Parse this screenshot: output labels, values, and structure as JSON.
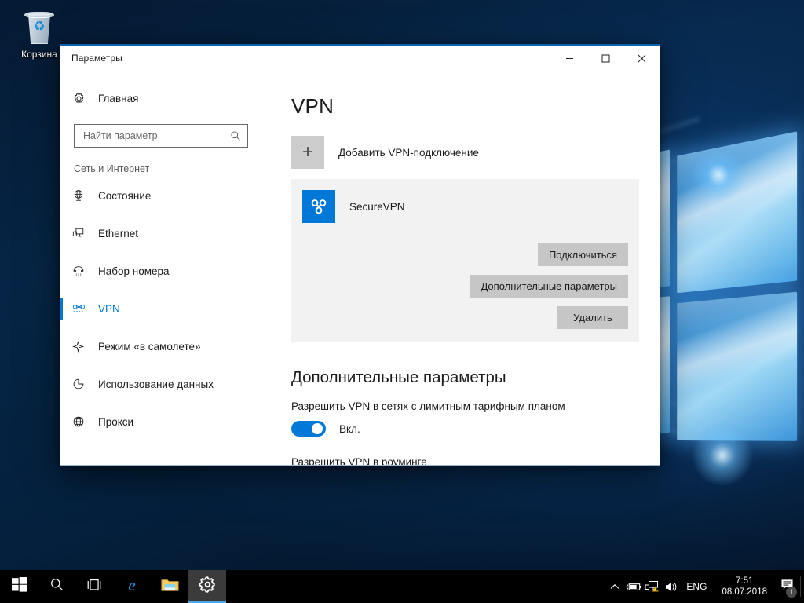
{
  "desktop": {
    "recycle_bin_label": "Корзина",
    "wallpaper_accent": "#0c67b5"
  },
  "window": {
    "title": "Параметры",
    "controls": {
      "minimize": "minimize-icon",
      "maximize": "maximize-icon",
      "close": "close-icon"
    }
  },
  "sidebar": {
    "home_label": "Главная",
    "home_icon": "gear-icon",
    "search": {
      "placeholder": "Найти параметр",
      "value": "",
      "icon": "search-icon"
    },
    "group_title": "Сеть и Интернет",
    "items": [
      {
        "label": "Состояние",
        "icon": "globe-status-icon",
        "active": false
      },
      {
        "label": "Ethernet",
        "icon": "ethernet-icon",
        "active": false
      },
      {
        "label": "Набор номера",
        "icon": "dialup-icon",
        "active": false
      },
      {
        "label": "VPN",
        "icon": "vpn-icon",
        "active": true
      },
      {
        "label": "Режим «в самолете»",
        "icon": "airplane-icon",
        "active": false
      },
      {
        "label": "Использование данных",
        "icon": "data-usage-icon",
        "active": false
      },
      {
        "label": "Прокси",
        "icon": "proxy-globe-icon",
        "active": false
      }
    ],
    "active_color": "#0078d7"
  },
  "main": {
    "page_title": "VPN",
    "add_connection": {
      "label": "Добавить VPN-подключение",
      "icon": "plus-icon"
    },
    "connection": {
      "name": "SecureVPN",
      "icon": "vpn-connection-icon",
      "icon_color": "#0078d7",
      "buttons": [
        {
          "label": "Подключиться",
          "name": "connect-button"
        },
        {
          "label": "Дополнительные параметры",
          "name": "advanced-options-button"
        },
        {
          "label": "Удалить",
          "name": "remove-button"
        }
      ]
    },
    "advanced": {
      "section_title": "Дополнительные параметры",
      "metered": {
        "label": "Разрешить VPN в сетях с лимитным тарифным планом",
        "state": "Вкл.",
        "on": true
      },
      "roaming": {
        "label": "Разрешить VPN в роуминге"
      }
    }
  },
  "taskbar": {
    "buttons": [
      {
        "name": "start-button",
        "icon": "windows-logo-icon",
        "active": false
      },
      {
        "name": "search-button",
        "icon": "search-icon",
        "active": false
      },
      {
        "name": "task-view-button",
        "icon": "task-view-icon",
        "active": false
      },
      {
        "name": "edge-button",
        "icon": "edge-icon",
        "active": false
      },
      {
        "name": "file-explorer-button",
        "icon": "folder-icon",
        "active": false
      },
      {
        "name": "settings-taskbar-button",
        "icon": "gear-icon",
        "active": true
      }
    ],
    "tray": {
      "chevron": "chevron-up-icon",
      "battery": "battery-charging-icon",
      "network": "network-warning-icon",
      "volume": "speaker-icon",
      "language": "ENG"
    },
    "clock": {
      "time": "7:51",
      "date": "08.07.2018"
    },
    "action_center": {
      "icon": "notification-icon",
      "badge": "1"
    }
  }
}
